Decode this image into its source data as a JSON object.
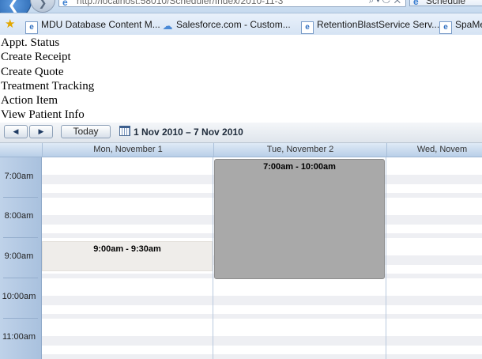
{
  "browser": {
    "address": "http://localhost:58010/Scheduler/Index/2010-11-3",
    "tab_title": "Schedule",
    "favorites": [
      {
        "label": "MDU Database Content M...",
        "icon": "ie-page-icon"
      },
      {
        "label": "Salesforce.com - Custom...",
        "icon": "cloud-icon"
      },
      {
        "label": "RetentionBlastService Serv...",
        "icon": "ie-page-icon"
      },
      {
        "label": "SpaMe",
        "icon": "ie-page-icon"
      }
    ]
  },
  "menu": {
    "items": [
      "Appt. Status",
      "Create Receipt",
      "Create Quote",
      "Treatment Tracking",
      "Action Item",
      "View Patient Info"
    ]
  },
  "toolbar": {
    "prev_label": "◀",
    "next_label": "▶",
    "today_label": "Today",
    "date_range": "1 Nov 2010 – 7 Nov 2010"
  },
  "calendar": {
    "days": [
      "Mon, November 1",
      "Tue, November 2",
      "Wed, Novem"
    ],
    "times": [
      "7:00am",
      "8:00am",
      "9:00am",
      "10:00am",
      "11:00am"
    ],
    "appointments": [
      {
        "label": "9:00am - 9:30am",
        "day": "Mon, November 1",
        "color": "#efedea"
      },
      {
        "label": "7:00am - 10:00am",
        "day": "Tue, November 2",
        "color": "#a9a9a9"
      }
    ]
  }
}
